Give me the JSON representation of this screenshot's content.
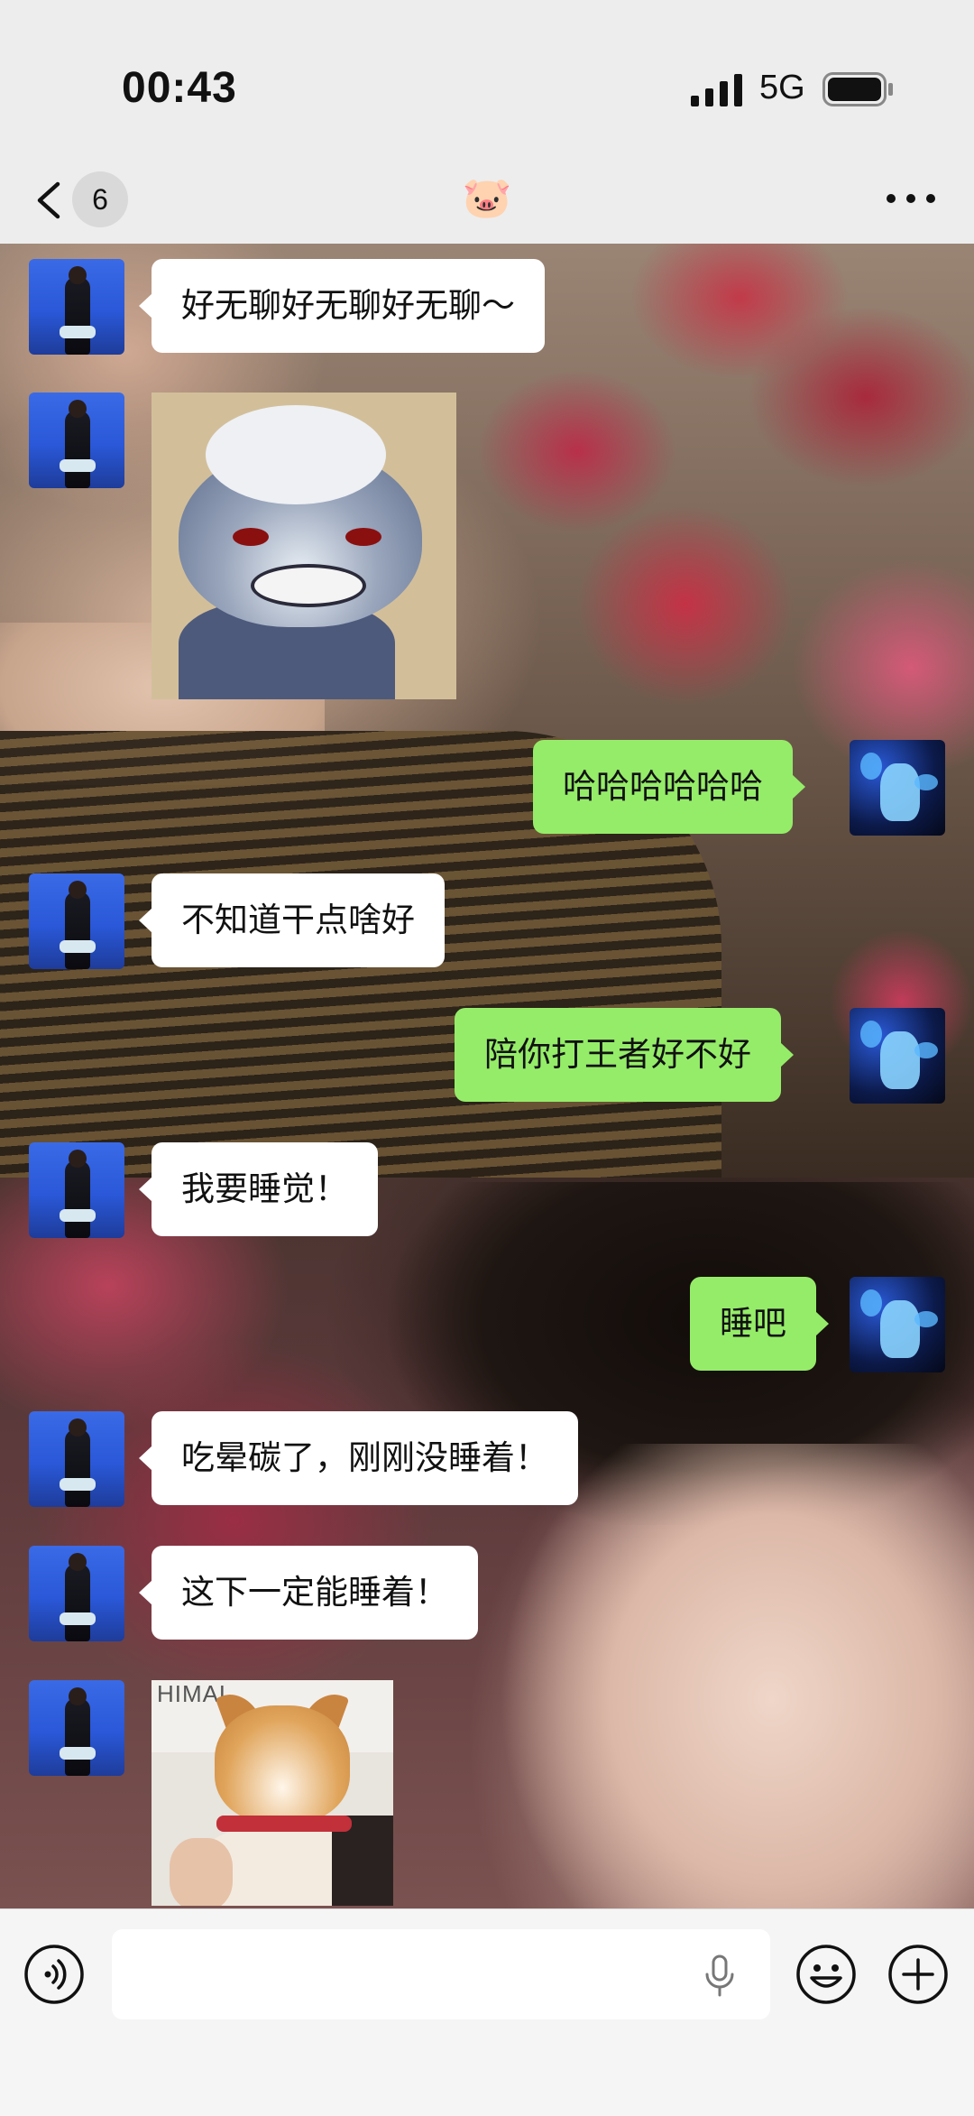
{
  "status_bar": {
    "time": "00:43",
    "network": "5G",
    "signal_icon": "signal-bars-icon",
    "battery_icon": "battery-icon"
  },
  "header": {
    "back_icon": "chevron-left-icon",
    "unread_count": "6",
    "title": "🐷",
    "more_icon": "more-dots-icon"
  },
  "messages": [
    {
      "side": "left",
      "type": "text",
      "text": "好无聊好无聊好无聊～"
    },
    {
      "side": "left",
      "type": "sticker",
      "sticker": "tom-cat-sticker"
    },
    {
      "side": "right",
      "type": "text",
      "text": "哈哈哈哈哈哈"
    },
    {
      "side": "left",
      "type": "text",
      "text": "不知道干点啥好"
    },
    {
      "side": "right",
      "type": "text",
      "text": "陪你打王者好不好"
    },
    {
      "side": "left",
      "type": "text",
      "text": "我要睡觉！"
    },
    {
      "side": "right",
      "type": "text",
      "text": "睡吧"
    },
    {
      "side": "left",
      "type": "text",
      "text": "吃晕碳了，刚刚没睡着！"
    },
    {
      "side": "left",
      "type": "text",
      "text": "这下一定能睡着！"
    },
    {
      "side": "left",
      "type": "sticker",
      "sticker": "shiba-dog-sticker",
      "caption": "HIMAL"
    }
  ],
  "input_bar": {
    "voice_icon": "voice-mode-icon",
    "input_value": "",
    "mic_icon": "microphone-icon",
    "emoji_icon": "emoji-icon",
    "plus_icon": "plus-circle-icon"
  },
  "colors": {
    "bubble_left": "#ffffff",
    "bubble_right": "#95ec69",
    "header_bg": "#ededed",
    "input_bar_bg": "#f5f5f5"
  }
}
